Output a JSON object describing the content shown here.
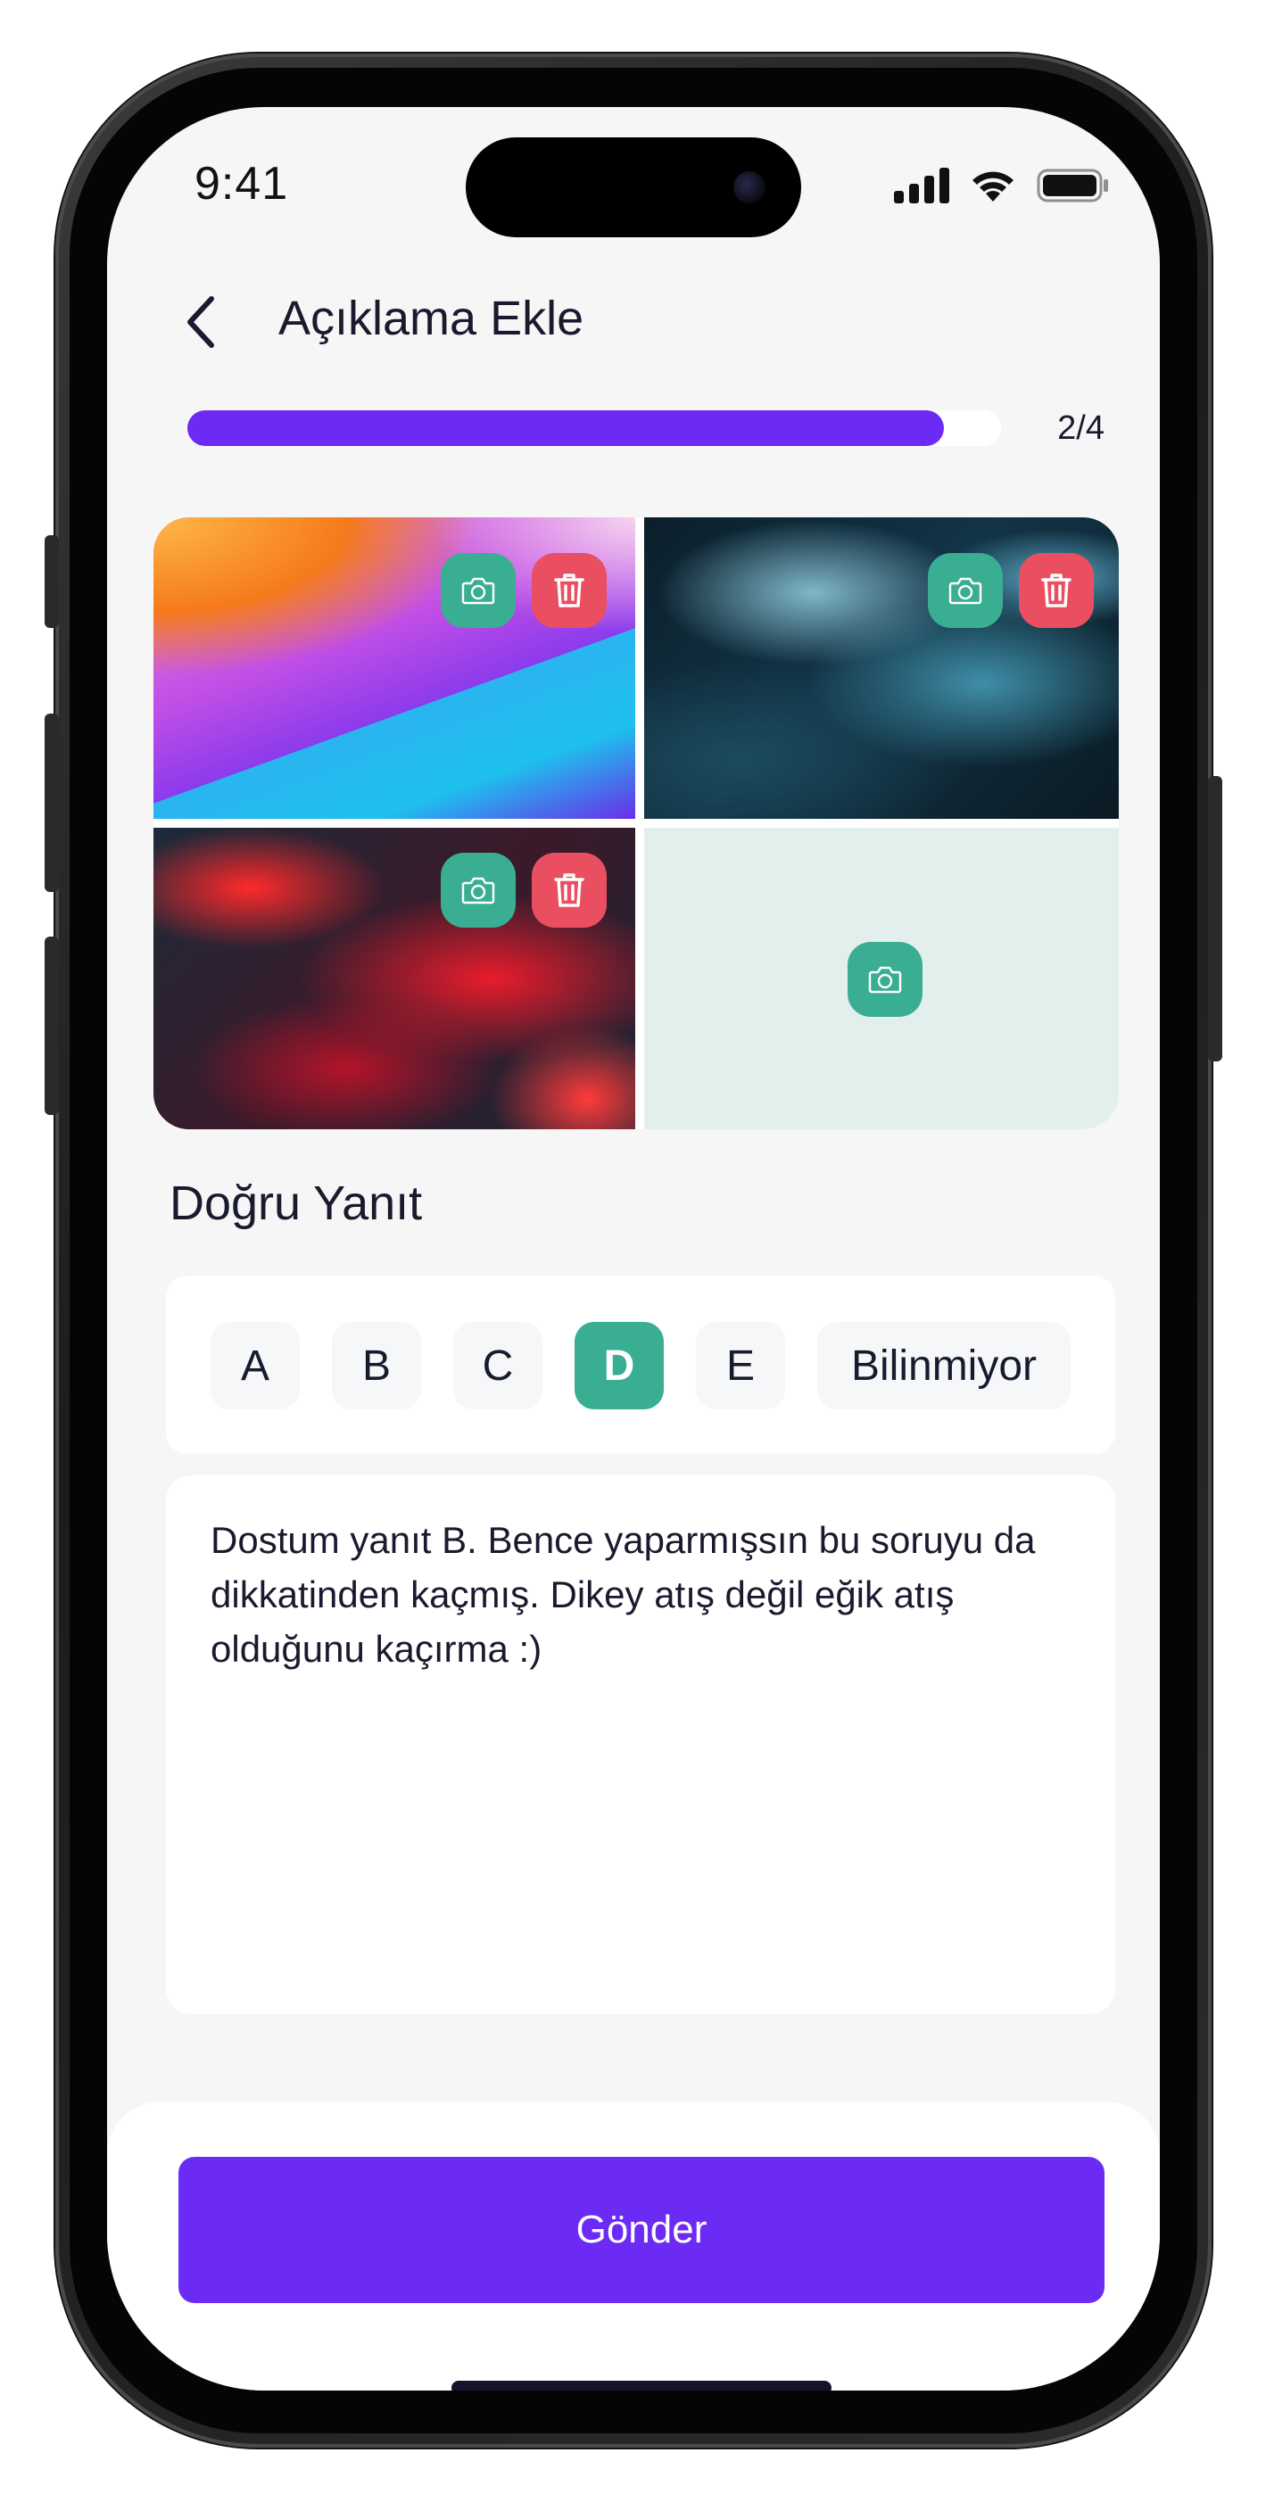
{
  "status_bar": {
    "time": "9:41"
  },
  "header": {
    "title": "Açıklama Ekle"
  },
  "progress": {
    "label": "2/4",
    "fraction": 0.5,
    "fill_ratio": 0.93
  },
  "photos": [
    {
      "name": "gradient-wallpaper",
      "has_image": true
    },
    {
      "name": "blue-marble-texture",
      "has_image": true
    },
    {
      "name": "red-fluid-art",
      "has_image": true
    },
    {
      "name": "empty-slot",
      "has_image": false
    }
  ],
  "answer": {
    "title": "Doğru Yanıt",
    "options": [
      "A",
      "B",
      "C",
      "D",
      "E",
      "Bilinmiyor"
    ],
    "selected": "D"
  },
  "comment": {
    "text": "Dostum yanıt B. Bence yaparmışsın bu soruyu da dikkatinden kaçmış. Dikey atış değil eğik atış olduğunu kaçırma :)"
  },
  "footer": {
    "send_label": "Gönder"
  },
  "colors": {
    "accent": "#6c2bf5",
    "teal": "#3aae93",
    "danger": "#ea4f61",
    "background": "#f6f6f7"
  },
  "icons": [
    "back-chevron-icon",
    "camera-icon",
    "trash-icon",
    "signal-icon",
    "wifi-icon",
    "battery-icon"
  ]
}
